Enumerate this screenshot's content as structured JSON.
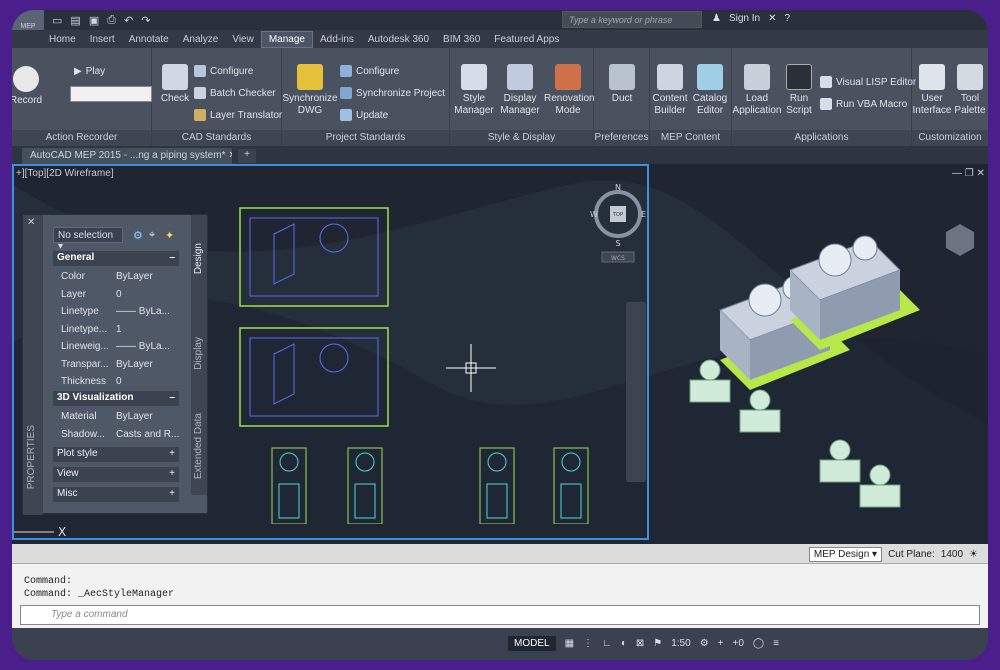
{
  "app": {
    "badge": "MEP",
    "search_placeholder": "Type a keyword or phrase",
    "sign_in": "Sign In"
  },
  "tabs": [
    "Home",
    "Insert",
    "Annotate",
    "Analyze",
    "View",
    "Manage",
    "Add-ins",
    "Autodesk 360",
    "BIM 360",
    "Featured Apps"
  ],
  "active_tab": "Manage",
  "ribbon": {
    "action_recorder": {
      "title": "Action Recorder",
      "record": "Record",
      "play": "Play"
    },
    "cad_standards": {
      "title": "CAD Standards",
      "check": "Check",
      "configure": "Configure",
      "batch_checker": "Batch Checker",
      "layer_translator": "Layer Translator"
    },
    "project_standards": {
      "title": "Project Standards",
      "synchronize_dwg": "Synchronize DWG",
      "configure": "Configure",
      "synchronize_project": "Synchronize Project",
      "update": "Update"
    },
    "style_display": {
      "title": "Style & Display",
      "style_manager": "Style Manager",
      "display_manager": "Display Manager",
      "renovation_mode": "Renovation Mode"
    },
    "preferences": {
      "title": "Preferences",
      "duct": "Duct"
    },
    "mep_content": {
      "title": "MEP Content",
      "content_builder": "Content Builder",
      "catalog_editor": "Catalog Editor"
    },
    "applications": {
      "title": "Applications",
      "load_application": "Load Application",
      "run_script": "Run Script",
      "visual_lisp_editor": "Visual LISP Editor",
      "run_vba_macro": "Run VBA Macro"
    },
    "customization": {
      "title": "Customization",
      "user_interface": "User Interface",
      "tool_palettes": "Tool Palette"
    }
  },
  "document_tab": "AutoCAD MEP 2015 - ...ng a piping system*",
  "viewport_label": "+][Top][2D Wireframe]",
  "compass": {
    "n": "N",
    "e": "E",
    "s": "S",
    "w": "W",
    "top": "TOP",
    "wcs": "WCS"
  },
  "properties": {
    "selection": "No selection",
    "side_label": "PROPERTIES",
    "tab_design": "Design",
    "tab_display": "Display",
    "tab_extended": "Extended Data",
    "general_title": "General",
    "general_rows": [
      {
        "k": "Color",
        "v": "ByLayer"
      },
      {
        "k": "Layer",
        "v": "0"
      },
      {
        "k": "Linetype",
        "v": "—— ByLa..."
      },
      {
        "k": "Linetype...",
        "v": "1"
      },
      {
        "k": "Lineweig...",
        "v": "—— ByLa..."
      },
      {
        "k": "Transpar...",
        "v": "ByLayer"
      },
      {
        "k": "Thickness",
        "v": "0"
      }
    ],
    "viz_title": "3D Visualization",
    "viz_rows": [
      {
        "k": "Material",
        "v": "ByLayer"
      },
      {
        "k": "Shadow...",
        "v": "Casts and R..."
      }
    ],
    "collapsed": [
      "Plot style",
      "View",
      "Misc"
    ]
  },
  "status_top": {
    "design": "MEP Design",
    "cut_plane_label": "Cut Plane:",
    "cut_plane_value": "1400"
  },
  "command": {
    "lines": [
      "Command:",
      "Command: _AecStyleManager"
    ],
    "placeholder": "Type a command"
  },
  "statusbar": {
    "model": "MODEL",
    "scale": "1:50",
    "plus_zero": "+0"
  },
  "colors": {
    "accent": "#3f8fe0",
    "green": "#9be050",
    "cyan": "#4ad8d8"
  }
}
